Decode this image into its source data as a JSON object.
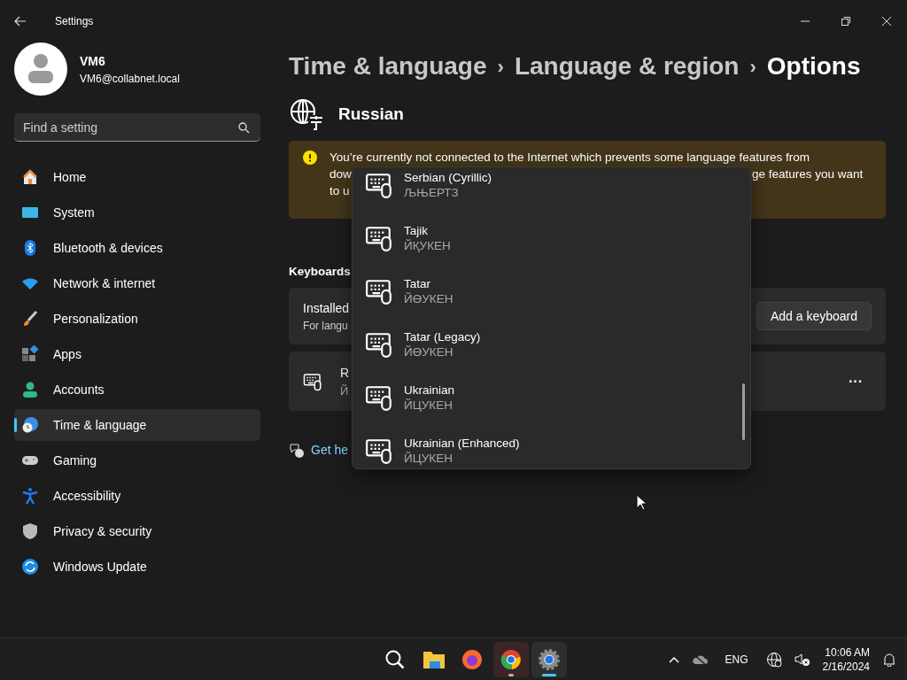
{
  "window": {
    "title": "Settings"
  },
  "user": {
    "name": "VM6",
    "email": "VM6@collabnet.local"
  },
  "search": {
    "placeholder": "Find a setting"
  },
  "sidebar": {
    "items": [
      {
        "label": "Home",
        "kind": "home",
        "selected": false
      },
      {
        "label": "System",
        "kind": "system",
        "selected": false
      },
      {
        "label": "Bluetooth & devices",
        "kind": "bluetooth",
        "selected": false
      },
      {
        "label": "Network & internet",
        "kind": "network",
        "selected": false
      },
      {
        "label": "Personalization",
        "kind": "brush",
        "selected": false
      },
      {
        "label": "Apps",
        "kind": "apps",
        "selected": false
      },
      {
        "label": "Accounts",
        "kind": "accounts",
        "selected": false
      },
      {
        "label": "Time & language",
        "kind": "time",
        "selected": true
      },
      {
        "label": "Gaming",
        "kind": "gaming",
        "selected": false
      },
      {
        "label": "Accessibility",
        "kind": "accessibility",
        "selected": false
      },
      {
        "label": "Privacy & security",
        "kind": "privacy",
        "selected": false
      },
      {
        "label": "Windows Update",
        "kind": "update",
        "selected": false
      }
    ]
  },
  "breadcrumb": [
    {
      "label": "Time & language",
      "current": false
    },
    {
      "label": "Language & region",
      "current": false
    },
    {
      "label": "Options",
      "current": true
    }
  ],
  "breadcrumb_separator": "›",
  "language": {
    "name": "Russian"
  },
  "warning": {
    "lines": [
      "You’re currently not connected to the Internet which prevents some language features from"
    ],
    "line_2_start": "dow",
    "line_2_end": "ge features you want",
    "line_3_start": "to u"
  },
  "keyboards": {
    "heading": "Keyboards",
    "installed_title": "Installed",
    "installed_subtitle": "For langu",
    "add_button": "Add a keyboard",
    "row_title": "R",
    "row_subtitle": "Й",
    "more_button": "···"
  },
  "help_link": "Get he",
  "dropdown": {
    "items": [
      {
        "name": "Serbian (Cyrillic)",
        "layout": "ЉЊЕРТЗ"
      },
      {
        "name": "Tajik",
        "layout": "ЙҚУКЕН"
      },
      {
        "name": "Tatar",
        "layout": "ЙӨУКЕН"
      },
      {
        "name": "Tatar (Legacy)",
        "layout": "ЙӨУКЕН"
      },
      {
        "name": "Ukrainian",
        "layout": "ЙЦУКЕН"
      },
      {
        "name": "Ukrainian (Enhanced)",
        "layout": "ЙЦУКЕН"
      }
    ]
  },
  "taskbar": {
    "apps": [
      {
        "kind": "search",
        "running": false,
        "selected": false
      },
      {
        "kind": "folder",
        "running": false,
        "selected": false
      },
      {
        "kind": "firefox",
        "running": false,
        "selected": false
      },
      {
        "kind": "chrome",
        "running": true,
        "selected": false
      },
      {
        "kind": "settings",
        "running": true,
        "selected": true
      }
    ],
    "language": "ENG",
    "time": "10:06 AM",
    "date": "2/16/2024"
  }
}
